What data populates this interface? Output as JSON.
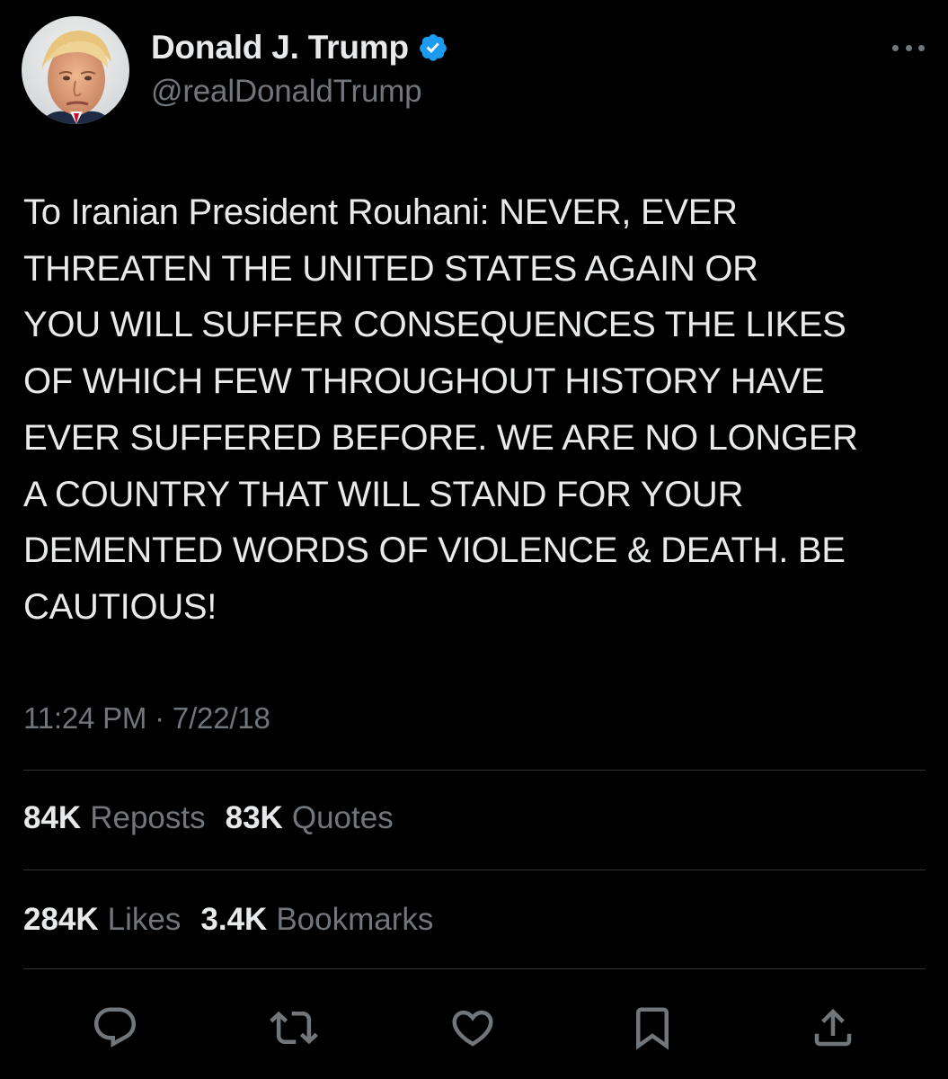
{
  "author": {
    "display_name": "Donald J. Trump",
    "handle": "@realDonaldTrump",
    "verified": true,
    "verified_color": "#1d9bf0"
  },
  "tweet": {
    "text": "To Iranian President Rouhani: NEVER, EVER\nTHREATEN THE UNITED STATES AGAIN OR\nYOU WILL SUFFER CONSEQUENCES THE LIKES\nOF WHICH FEW THROUGHOUT HISTORY HAVE\nEVER SUFFERED BEFORE. WE ARE NO LONGER\nA COUNTRY THAT WILL STAND FOR YOUR\nDEMENTED WORDS OF VIOLENCE & DEATH. BE\nCAUTIOUS!",
    "timestamp": "11:24 PM · 7/22/18"
  },
  "stats": {
    "reposts": {
      "count": "84K",
      "label": "Reposts"
    },
    "quotes": {
      "count": "83K",
      "label": "Quotes"
    },
    "likes": {
      "count": "284K",
      "label": "Likes"
    },
    "bookmarks": {
      "count": "3.4K",
      "label": "Bookmarks"
    }
  },
  "actions": [
    "reply-icon",
    "repost-icon",
    "like-icon",
    "bookmark-icon",
    "share-icon"
  ],
  "colors": {
    "background": "#000000",
    "text": "#e7e9ea",
    "secondary": "#71767b",
    "divider": "#2f3336",
    "accent": "#1d9bf0"
  }
}
